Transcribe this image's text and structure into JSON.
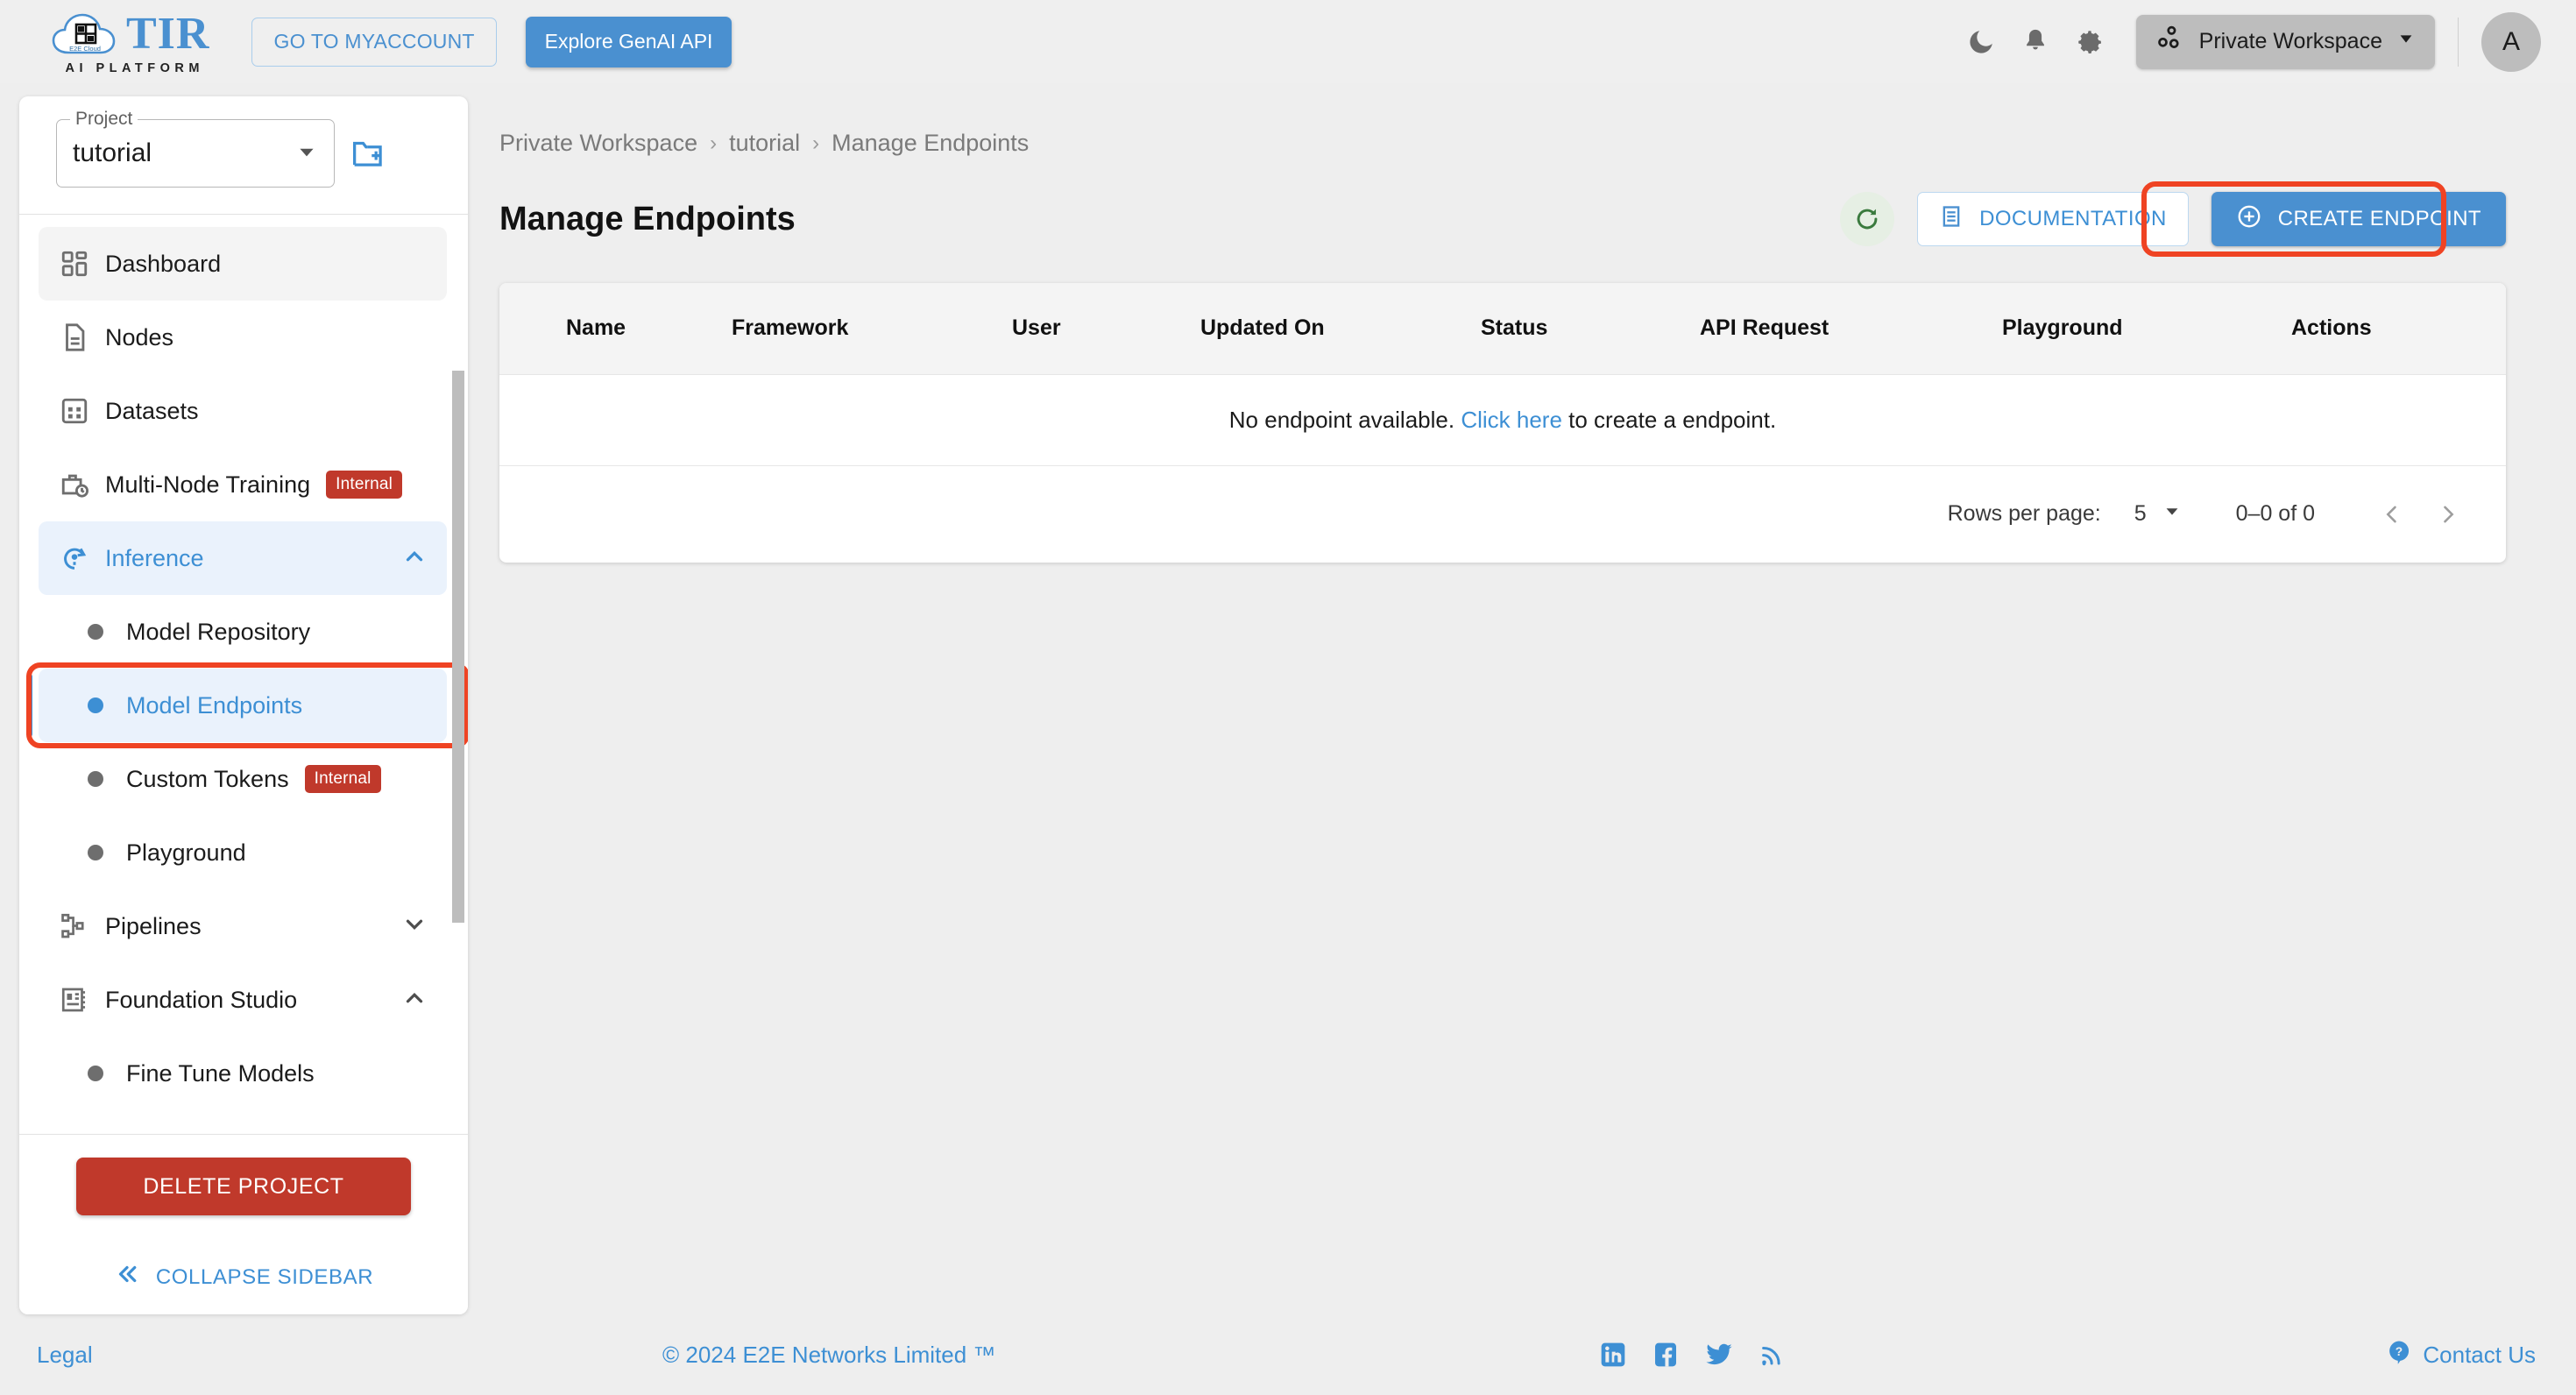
{
  "topbar": {
    "logo_word": "TIR",
    "logo_sub": "AI PLATFORM",
    "logo_cloud_text": "E2E Cloud",
    "myaccount_label": "GO TO MYACCOUNT",
    "genai_label": "Explore GenAI API",
    "dark_mode_icon": "moon-icon",
    "notifications_icon": "bell-icon",
    "settings_icon": "gear-icon",
    "workspace_icon": "workspace-group-icon",
    "workspace_label": "Private Workspace",
    "workspace_caret": "chevron-down-icon",
    "avatar_initial": "A"
  },
  "sidebar": {
    "project_legend": "Project",
    "project_value": "tutorial",
    "new_folder_icon": "new-folder-icon",
    "items": [
      {
        "label": "Dashboard",
        "icon": "dashboard-icon",
        "state": "hover"
      },
      {
        "label": "Nodes",
        "icon": "document-icon",
        "state": ""
      },
      {
        "label": "Datasets",
        "icon": "grid-table-icon",
        "state": ""
      },
      {
        "label": "Multi-Node Training",
        "icon": "briefcase-clock-icon",
        "badge": "Internal",
        "state": ""
      },
      {
        "label": "Inference",
        "icon": "inference-icon",
        "state": "expanded",
        "chevron": "chevron-up-icon"
      }
    ],
    "inference_children": [
      {
        "label": "Model Repository",
        "selected": false
      },
      {
        "label": "Model Endpoints",
        "selected": true
      },
      {
        "label": "Custom Tokens",
        "badge": "Internal",
        "selected": false
      },
      {
        "label": "Playground",
        "selected": false
      }
    ],
    "items_after": [
      {
        "label": "Pipelines",
        "icon": "pipeline-icon",
        "chevron": "chevron-down-icon"
      },
      {
        "label": "Foundation Studio",
        "icon": "foundation-studio-icon",
        "chevron": "chevron-up-icon"
      }
    ],
    "cutoff_item": {
      "label": "Fine Tune Models"
    },
    "delete_project_label": "DELETE PROJECT",
    "collapse_label": "COLLAPSE SIDEBAR",
    "collapse_icon": "double-chevron-left-icon"
  },
  "main": {
    "breadcrumb": [
      "Private Workspace",
      "tutorial",
      "Manage Endpoints"
    ],
    "breadcrumb_separator": "›",
    "page_title": "Manage Endpoints",
    "refresh_icon": "refresh-icon",
    "documentation_label": "DOCUMENTATION",
    "documentation_icon": "document-list-icon",
    "create_endpoint_label": "CREATE ENDPOINT",
    "create_endpoint_icon": "plus-circle-icon"
  },
  "table": {
    "columns": [
      "Name",
      "Framework",
      "User",
      "Updated On",
      "Status",
      "API Request",
      "Playground",
      "Actions"
    ],
    "rows": [],
    "empty_prefix": "No endpoint available. ",
    "empty_link": "Click here",
    "empty_suffix": " to create a endpoint."
  },
  "pagination": {
    "rows_per_page_label": "Rows per page:",
    "rows_per_page_value": "5",
    "caret_icon": "caret-down-icon",
    "range_label": "0–0 of 0",
    "prev_icon": "chevron-left-icon",
    "next_icon": "chevron-right-icon"
  },
  "footer": {
    "legal": "Legal",
    "copyright": "© 2024 E2E Networks Limited ™",
    "social": [
      "linkedin-icon",
      "facebook-icon",
      "twitter-icon",
      "rss-icon"
    ],
    "contact_label": "Contact Us",
    "contact_icon": "help-circle-icon"
  },
  "colors": {
    "accent_blue": "#4a90d0",
    "link_blue": "#3d8fd4",
    "danger_red": "#c0392b",
    "highlight_ring": "#ef4323",
    "page_bg": "#eeeeee",
    "selected_bg": "#eaf2fc"
  }
}
